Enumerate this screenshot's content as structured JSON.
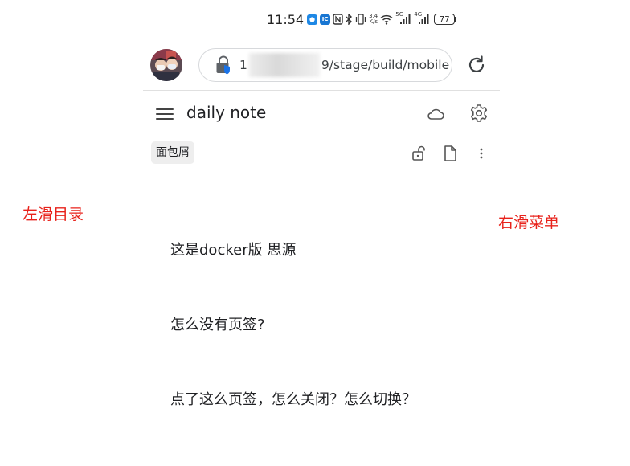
{
  "status_bar": {
    "time": "11:54",
    "net_speed_value": "3.4",
    "net_speed_unit": "K/s",
    "signal_1_label": "5G",
    "signal_2_label": "4G",
    "battery": "77"
  },
  "browser": {
    "url_prefix": "1",
    "url_suffix": "9/stage/build/mobile"
  },
  "app": {
    "title": "daily note",
    "breadcrumb": "面包屑"
  },
  "annotations": {
    "left": "左滑目录",
    "right": "右滑菜单"
  },
  "content": {
    "paragraphs": [
      "这是docker版 思源",
      "怎么没有页签?",
      "点了这么页签，怎么关闭？怎么切换？"
    ]
  },
  "icons": {
    "menu": "hamburger-menu-icon",
    "cloud": "cloud-icon",
    "settings": "gear-icon",
    "lock": "lock-open-icon",
    "doc": "document-icon",
    "more": "more-vertical-icon",
    "reload": "reload-icon"
  },
  "colors": {
    "annotation_red": "#e8221b",
    "text": "#202124",
    "breadcrumb_bg": "#eeeeee"
  }
}
